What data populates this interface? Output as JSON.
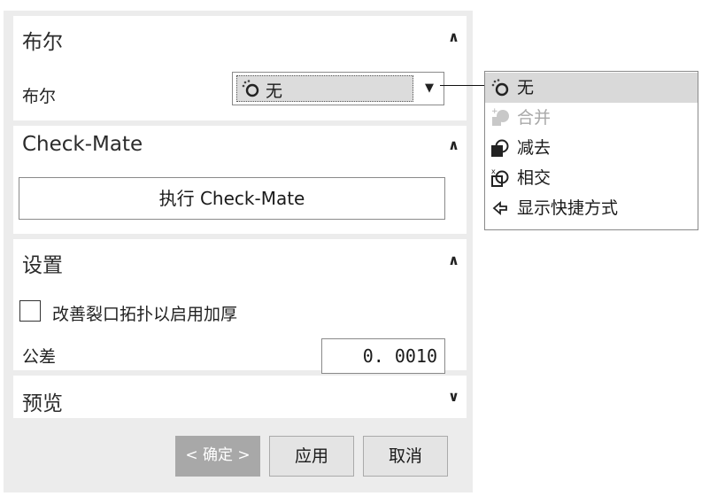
{
  "boolean": {
    "title": "布尔",
    "field_label": "布尔",
    "selected": "无"
  },
  "checkmate": {
    "title": "Check-Mate",
    "execute_label": "执行 Check-Mate"
  },
  "settings": {
    "title": "设置",
    "checkbox_label": "改善裂口拓扑以启用加厚",
    "checkbox_checked": false,
    "tolerance_label": "公差",
    "tolerance_value": "0. 0010"
  },
  "preview": {
    "title": "预览"
  },
  "buttons": {
    "ok": "< 确定 >",
    "apply": "应用",
    "cancel": "取消"
  },
  "dropdown": {
    "options": [
      {
        "label": "无",
        "icon": "bool-none-icon",
        "selected": true,
        "disabled": false
      },
      {
        "label": "合并",
        "icon": "bool-unite-icon",
        "selected": false,
        "disabled": true
      },
      {
        "label": "减去",
        "icon": "bool-subtract-icon",
        "selected": false,
        "disabled": false
      },
      {
        "label": "相交",
        "icon": "bool-intersect-icon",
        "selected": false,
        "disabled": false
      },
      {
        "label": "显示快捷方式",
        "icon": "shortcut-arrow-icon",
        "selected": false,
        "disabled": false
      }
    ]
  },
  "colors": {
    "panel_bg": "#ececec",
    "selected_bg": "#d9d9d9",
    "ok_button_bg": "#a8a8a8"
  }
}
